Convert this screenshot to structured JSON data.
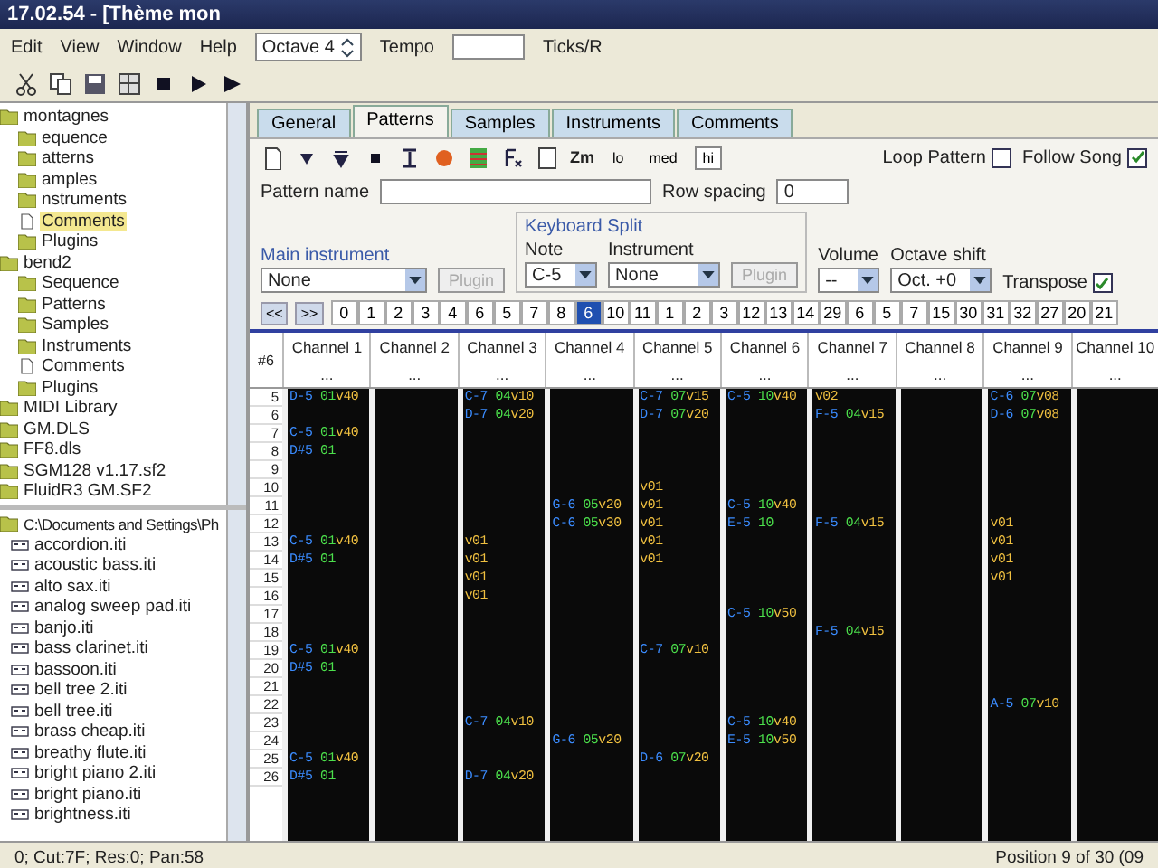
{
  "window": {
    "title": "17.02.54 - [Thème mon"
  },
  "menu": [
    "Edit",
    "View",
    "Window",
    "Help"
  ],
  "toolbar": {
    "octave": "Octave 4",
    "tempo_label": "Tempo",
    "ticks_label": "Ticks/R"
  },
  "tree": [
    {
      "label": "montagnes",
      "kind": "folder",
      "selected": false,
      "children": [
        {
          "label": "equence",
          "kind": "folder",
          "selected": false
        },
        {
          "label": "atterns",
          "kind": "folder",
          "selected": false
        },
        {
          "label": "amples",
          "kind": "folder",
          "selected": false
        },
        {
          "label": "nstruments",
          "kind": "folder",
          "selected": false
        },
        {
          "label": "Comments",
          "kind": "document",
          "selected": true
        },
        {
          "label": "Plugins",
          "kind": "folder",
          "selected": false
        }
      ]
    },
    {
      "label": "bend2",
      "kind": "folder",
      "selected": false,
      "children": [
        {
          "label": "Sequence",
          "kind": "folder",
          "selected": false
        },
        {
          "label": "Patterns",
          "kind": "folder",
          "selected": false
        },
        {
          "label": "Samples",
          "kind": "folder",
          "selected": false
        },
        {
          "label": "Instruments",
          "kind": "folder",
          "selected": false
        },
        {
          "label": "Comments",
          "kind": "document",
          "selected": false
        },
        {
          "label": "Plugins",
          "kind": "folder",
          "selected": false
        }
      ]
    },
    {
      "label": "MIDI Library",
      "kind": "folder",
      "selected": false
    },
    {
      "label": "GM.DLS",
      "kind": "folder",
      "selected": false
    },
    {
      "label": "FF8.dls",
      "kind": "folder",
      "selected": false
    },
    {
      "label": "SGM128 v1.17.sf2",
      "kind": "folder",
      "selected": false
    },
    {
      "label": "FluidR3 GM.SF2",
      "kind": "folder",
      "selected": false
    }
  ],
  "files": {
    "folder": "C:\\Documents and Settings\\Ph",
    "items": [
      "accordion.iti",
      "acoustic bass.iti",
      "alto sax.iti",
      "analog sweep pad.iti",
      "banjo.iti",
      "bass clarinet.iti",
      "bassoon.iti",
      "bell tree 2.iti",
      "bell tree.iti",
      "brass cheap.iti",
      "breathy flute.iti",
      "bright piano 2.iti",
      "bright piano.iti",
      "brightness.iti"
    ]
  },
  "tabs": [
    {
      "label": "General",
      "selected": false
    },
    {
      "label": "Patterns",
      "selected": true
    },
    {
      "label": "Samples",
      "selected": false
    },
    {
      "label": "Instruments",
      "selected": false
    },
    {
      "label": "Comments",
      "selected": false
    }
  ],
  "zoom_label": "Zm",
  "quality": [
    {
      "label": "lo",
      "selected": false
    },
    {
      "label": "med",
      "selected": false
    },
    {
      "label": "hi",
      "selected": true
    }
  ],
  "loop_pattern": {
    "label": "Loop Pattern",
    "checked": false
  },
  "follow_song": {
    "label": "Follow Song",
    "checked": true
  },
  "pattern_name": {
    "label": "Pattern name"
  },
  "row_spacing": {
    "label": "Row spacing",
    "value": "0"
  },
  "main_instrument": {
    "label": "Main instrument",
    "value": "None",
    "plugin": {
      "label": "Plugin",
      "disabled": true
    }
  },
  "keyboard_split": {
    "label": "Keyboard Split",
    "note_label": "Note",
    "note": "C-5",
    "instrument_label": "Instrument",
    "instrument": "None",
    "plugin": {
      "label": "Plugin",
      "disabled": true
    }
  },
  "volume": {
    "label": "Volume",
    "value": "--"
  },
  "octave_shift": {
    "label": "Octave shift",
    "value": "Oct. +0"
  },
  "transpose": {
    "label": "Transpose",
    "checked": true
  },
  "order_nav": [
    "<<",
    ">>"
  ],
  "orders": [
    {
      "label": "0",
      "selected": false
    },
    {
      "label": "1",
      "selected": false
    },
    {
      "label": "2",
      "selected": false
    },
    {
      "label": "3",
      "selected": false
    },
    {
      "label": "4",
      "selected": false
    },
    {
      "label": "6",
      "selected": false
    },
    {
      "label": "5",
      "selected": false
    },
    {
      "label": "7",
      "selected": false
    },
    {
      "label": "8",
      "selected": false
    },
    {
      "label": "6",
      "selected": true
    },
    {
      "label": "10",
      "selected": false
    },
    {
      "label": "11",
      "selected": false
    },
    {
      "label": "1",
      "selected": false
    },
    {
      "label": "2",
      "selected": false
    },
    {
      "label": "3",
      "selected": false
    },
    {
      "label": "12",
      "selected": false
    },
    {
      "label": "13",
      "selected": false
    },
    {
      "label": "14",
      "selected": false
    },
    {
      "label": "29",
      "selected": false
    },
    {
      "label": "6",
      "selected": false
    },
    {
      "label": "5",
      "selected": false
    },
    {
      "label": "7",
      "selected": false
    },
    {
      "label": "15",
      "selected": false
    },
    {
      "label": "30",
      "selected": false
    },
    {
      "label": "31",
      "selected": false
    },
    {
      "label": "32",
      "selected": false
    },
    {
      "label": "27",
      "selected": false
    },
    {
      "label": "20",
      "selected": false
    },
    {
      "label": "21",
      "selected": false
    }
  ],
  "pattern": {
    "number": "#6",
    "channels": [
      {
        "name": "Channel 1",
        "marker": "..."
      },
      {
        "name": "Channel 2",
        "marker": "..."
      },
      {
        "name": "Channel 3",
        "marker": "..."
      },
      {
        "name": "Channel 4",
        "marker": "..."
      },
      {
        "name": "Channel 5",
        "marker": "..."
      },
      {
        "name": "Channel 6",
        "marker": "..."
      },
      {
        "name": "Channel 7",
        "marker": "..."
      },
      {
        "name": "Channel 8",
        "marker": "..."
      },
      {
        "name": "Channel 9",
        "marker": "..."
      },
      {
        "name": "Channel 10",
        "marker": "..."
      }
    ],
    "rows": [
      {
        "number": "5",
        "channel_1": {
          "note": "D-5",
          "instrument": "01",
          "volume": "v40"
        },
        "channel_3": {
          "note": "C-7",
          "instrument": "04",
          "volume": "v10"
        },
        "channel_5": {
          "note": "C-7",
          "instrument": "07",
          "volume": "v15"
        },
        "channel_6": {
          "note": "C-5",
          "instrument": "10",
          "volume": "v40"
        },
        "channel_7": {
          "volume": "v02"
        },
        "channel_9": {
          "note": "C-6",
          "instrument": "07",
          "volume": "v08"
        }
      },
      {
        "number": "6",
        "channel_3": {
          "note": "D-7",
          "instrument": "04",
          "volume": "v20"
        },
        "channel_5": {
          "note": "D-7",
          "instrument": "07",
          "volume": "v20"
        },
        "channel_7": {
          "note": "F-5",
          "instrument": "04",
          "volume": "v15"
        },
        "channel_9": {
          "note": "D-6",
          "instrument": "07",
          "volume": "v08"
        }
      },
      {
        "number": "7",
        "channel_1": {
          "note": "C-5",
          "instrument": "01",
          "volume": "v40"
        }
      },
      {
        "number": "8",
        "channel_1": {
          "note": "D#5",
          "instrument": "01"
        }
      },
      {
        "number": "9"
      },
      {
        "number": "10",
        "channel_5": {
          "volume": "v01"
        }
      },
      {
        "number": "11",
        "channel_4": {
          "note": "G-6",
          "instrument": "05",
          "volume": "v20"
        },
        "channel_5": {
          "volume": "v01"
        },
        "channel_6": {
          "note": "C-5",
          "instrument": "10",
          "volume": "v40"
        }
      },
      {
        "number": "12",
        "channel_4": {
          "note": "C-6",
          "instrument": "05",
          "volume": "v30"
        },
        "channel_5": {
          "volume": "v01"
        },
        "channel_6": {
          "note": "E-5",
          "instrument": "10"
        },
        "channel_7": {
          "note": "F-5",
          "instrument": "04",
          "volume": "v15"
        },
        "channel_9": {
          "volume": "v01"
        }
      },
      {
        "number": "13",
        "channel_1": {
          "note": "C-5",
          "instrument": "01",
          "volume": "v40"
        },
        "channel_3": {
          "volume": "v01"
        },
        "channel_5": {
          "volume": "v01"
        },
        "channel_9": {
          "volume": "v01"
        }
      },
      {
        "number": "14",
        "channel_1": {
          "note": "D#5",
          "instrument": "01"
        },
        "channel_3": {
          "volume": "v01"
        },
        "channel_5": {
          "volume": "v01"
        },
        "channel_9": {
          "volume": "v01"
        }
      },
      {
        "number": "15",
        "channel_3": {
          "volume": "v01"
        },
        "channel_9": {
          "volume": "v01"
        }
      },
      {
        "number": "16",
        "channel_3": {
          "volume": "v01"
        }
      },
      {
        "number": "17",
        "channel_6": {
          "note": "C-5",
          "instrument": "10",
          "volume": "v50"
        }
      },
      {
        "number": "18",
        "channel_7": {
          "note": "F-5",
          "instrument": "04",
          "volume": "v15"
        }
      },
      {
        "number": "19",
        "channel_1": {
          "note": "C-5",
          "instrument": "01",
          "volume": "v40"
        },
        "channel_5": {
          "note": "C-7",
          "instrument": "07",
          "volume": "v10"
        }
      },
      {
        "number": "20",
        "channel_1": {
          "note": "D#5",
          "instrument": "01"
        }
      },
      {
        "number": "21"
      },
      {
        "number": "22",
        "channel_9": {
          "note": "A-5",
          "instrument": "07",
          "volume": "v10"
        }
      },
      {
        "number": "23",
        "channel_3": {
          "note": "C-7",
          "instrument": "04",
          "volume": "v10"
        },
        "channel_6": {
          "note": "C-5",
          "instrument": "10",
          "volume": "v40"
        }
      },
      {
        "number": "24",
        "channel_4": {
          "note": "G-6",
          "instrument": "05",
          "volume": "v20"
        },
        "channel_6": {
          "note": "E-5",
          "instrument": "10",
          "volume": "v50"
        }
      },
      {
        "number": "25",
        "channel_1": {
          "note": "C-5",
          "instrument": "01",
          "volume": "v40"
        },
        "channel_5": {
          "note": "D-6",
          "instrument": "07",
          "volume": "v20"
        }
      },
      {
        "number": "26",
        "channel_1": {
          "note": "D#5",
          "instrument": "01"
        },
        "channel_3": {
          "note": "D-7",
          "instrument": "04",
          "volume": "v20"
        }
      }
    ]
  },
  "status_bar": [
    "0; Cut:7F; Res:0; Pan:58",
    "Position 9 of 30 (09"
  ]
}
